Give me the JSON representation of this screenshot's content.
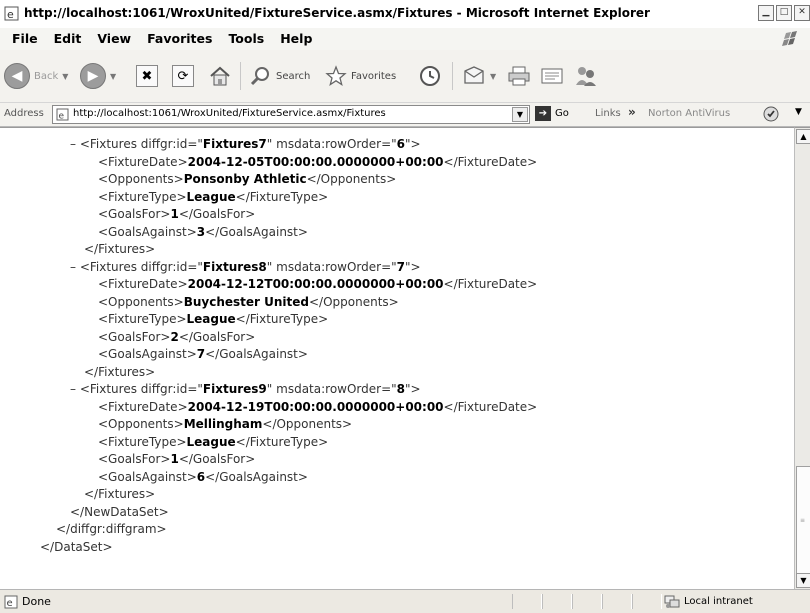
{
  "window": {
    "title": "http://localhost:1061/WroxUnited/FixtureService.asmx/Fixtures - Microsoft Internet Explorer"
  },
  "menu": [
    "File",
    "Edit",
    "View",
    "Favorites",
    "Tools",
    "Help"
  ],
  "toolbar": {
    "back_label": "Back",
    "search_label": "Search",
    "favorites_label": "Favorites"
  },
  "address": {
    "label": "Address",
    "url": "http://localhost:1061/WroxUnited/FixtureService.asmx/Fixtures",
    "go_label": "Go",
    "links_label": "Links",
    "chevron": "»",
    "norton_label": "Norton AntiVirus"
  },
  "xml": {
    "fixtures": [
      {
        "id": "Fixtures7",
        "row_order": "6",
        "date": "2004-12-05T00:00:00.0000000+00:00",
        "opponents": "Ponsonby Athletic",
        "type": "League",
        "goals_for": "1",
        "goals_against": "3"
      },
      {
        "id": "Fixtures8",
        "row_order": "7",
        "date": "2004-12-12T00:00:00.0000000+00:00",
        "opponents": "Buychester United",
        "type": "League",
        "goals_for": "2",
        "goals_against": "7"
      },
      {
        "id": "Fixtures9",
        "row_order": "8",
        "date": "2004-12-19T00:00:00.0000000+00:00",
        "opponents": "Mellingham",
        "type": "League",
        "goals_for": "1",
        "goals_against": "6"
      }
    ],
    "close_newdataset": "</NewDataSet>",
    "close_diffgram": "</diffgr:diffgram>",
    "close_dataset": "</DataSet>"
  },
  "status": {
    "text": "Done",
    "zone": "Local intranet"
  }
}
